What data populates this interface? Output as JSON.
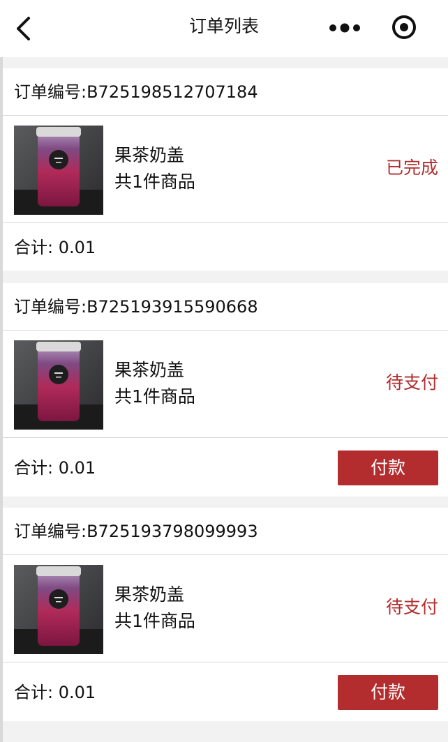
{
  "navbar": {
    "title": "订单列表"
  },
  "orders": [
    {
      "number_label": "订单编号:B725198512707184",
      "product_name": "果茶奶盖",
      "item_count": "共1件商品",
      "status": "已完成",
      "total": "合计: 0.01",
      "show_pay": false,
      "image_icon": "bubble-tea-image"
    },
    {
      "number_label": "订单编号:B725193915590668",
      "product_name": "果茶奶盖",
      "item_count": "共1件商品",
      "status": "待支付",
      "total": "合计: 0.01",
      "pay_label": "付款",
      "show_pay": true,
      "image_icon": "bubble-tea-image"
    },
    {
      "number_label": "订单编号:B725193798099993",
      "product_name": "果茶奶盖",
      "item_count": "共1件商品",
      "status": "待支付",
      "total": "合计: 0.01",
      "pay_label": "付款",
      "show_pay": true,
      "image_icon": "bubble-tea-image"
    }
  ],
  "colors": {
    "accent": "#b32d2e",
    "background": "#f2f2f2",
    "card": "#ffffff",
    "divider": "#d9d9d9"
  }
}
